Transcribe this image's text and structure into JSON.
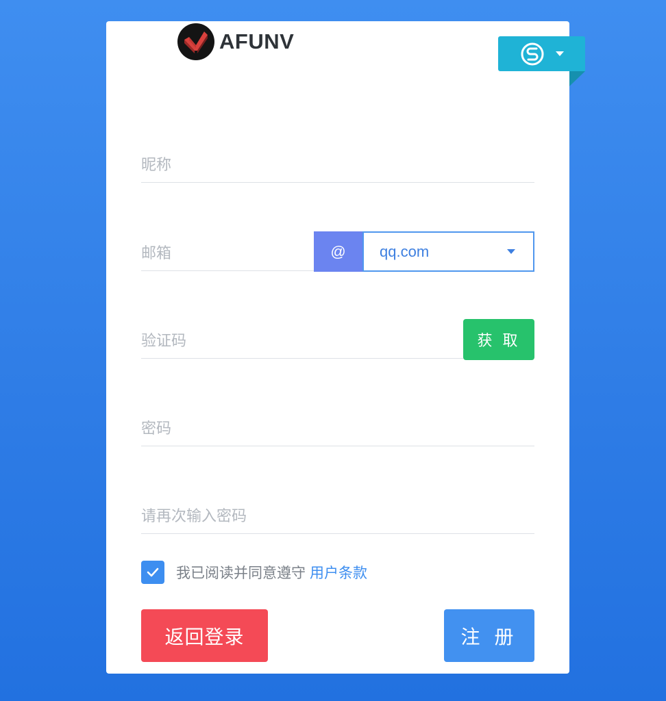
{
  "brand": {
    "name": "AFUNV",
    "logo_icon": "check-shield-logo-icon"
  },
  "language": {
    "icon": "language-switch-icon"
  },
  "form": {
    "nickname_placeholder": "昵称",
    "email_placeholder": "邮箱",
    "email_at": "@",
    "email_domain": "qq.com",
    "code_placeholder": "验证码",
    "get_code_label": "获 取",
    "password_placeholder": "密码",
    "confirm_password_placeholder": "请再次输入密码"
  },
  "agreement": {
    "checked": true,
    "text": "我已阅读并同意遵守",
    "link": "用户条款"
  },
  "actions": {
    "back_label": "返回登录",
    "register_label": "注 册"
  },
  "colors": {
    "background": "#3f8ef0",
    "language_toggle": "#1fb3d6",
    "at_box": "#6b84f0",
    "get_button": "#27c26c",
    "back_button": "#f44a56",
    "register_button": "#4291f0"
  }
}
